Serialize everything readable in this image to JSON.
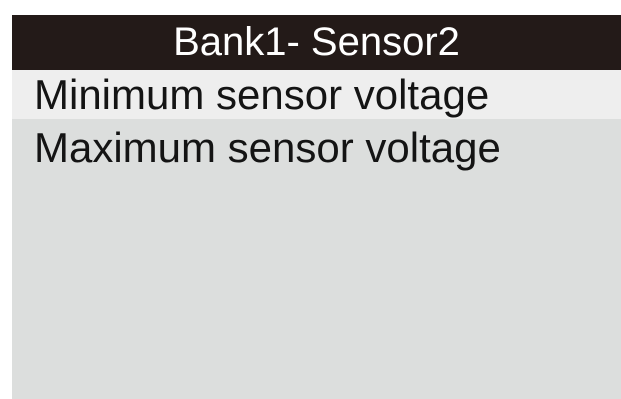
{
  "screen": {
    "title": "Bank1- Sensor2",
    "items": [
      {
        "label": "Minimum sensor voltage",
        "selected": true
      },
      {
        "label": "Maximum sensor voltage",
        "selected": false
      }
    ]
  },
  "colors": {
    "title_background": "#231a18",
    "title_text": "#ffffff",
    "screen_background": "#dcdedd",
    "selected_background": "#eeeeee",
    "item_text": "#141414"
  }
}
